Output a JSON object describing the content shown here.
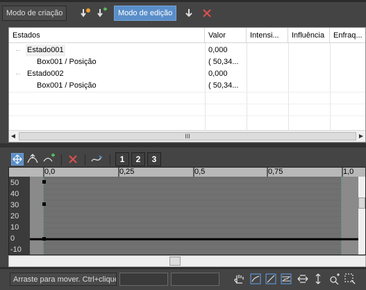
{
  "toolbar": {
    "create_mode_label": "Modo de criação",
    "edit_mode_label": "Modo de edição"
  },
  "table": {
    "headers": [
      "Estados",
      "Valor",
      "Intensi...",
      "Influência",
      "Enfraq..."
    ],
    "rows": [
      {
        "name": "Estado001",
        "value": "0,000"
      },
      {
        "name": "Box001 / Posição",
        "value": "( 50,34..."
      },
      {
        "name": "Estado002",
        "value": "0,000"
      },
      {
        "name": "Box001 / Posição",
        "value": "( 50,34..."
      }
    ],
    "scroll_grip": "III"
  },
  "curve_toolbar": {
    "buttons": [
      "1",
      "2",
      "3"
    ]
  },
  "graph": {
    "ruler_labels": [
      "0,0",
      "0,25",
      "0,5",
      "0,75",
      "1,0"
    ],
    "y_labels": [
      "50",
      "40",
      "30",
      "20",
      "10",
      "0",
      "-10"
    ]
  },
  "status": {
    "hint": "Arraste para mover. Ctrl+clique"
  },
  "colors": {
    "accent": "#5a8ec9",
    "delete_red": "#e05050",
    "curve": "#000000"
  }
}
